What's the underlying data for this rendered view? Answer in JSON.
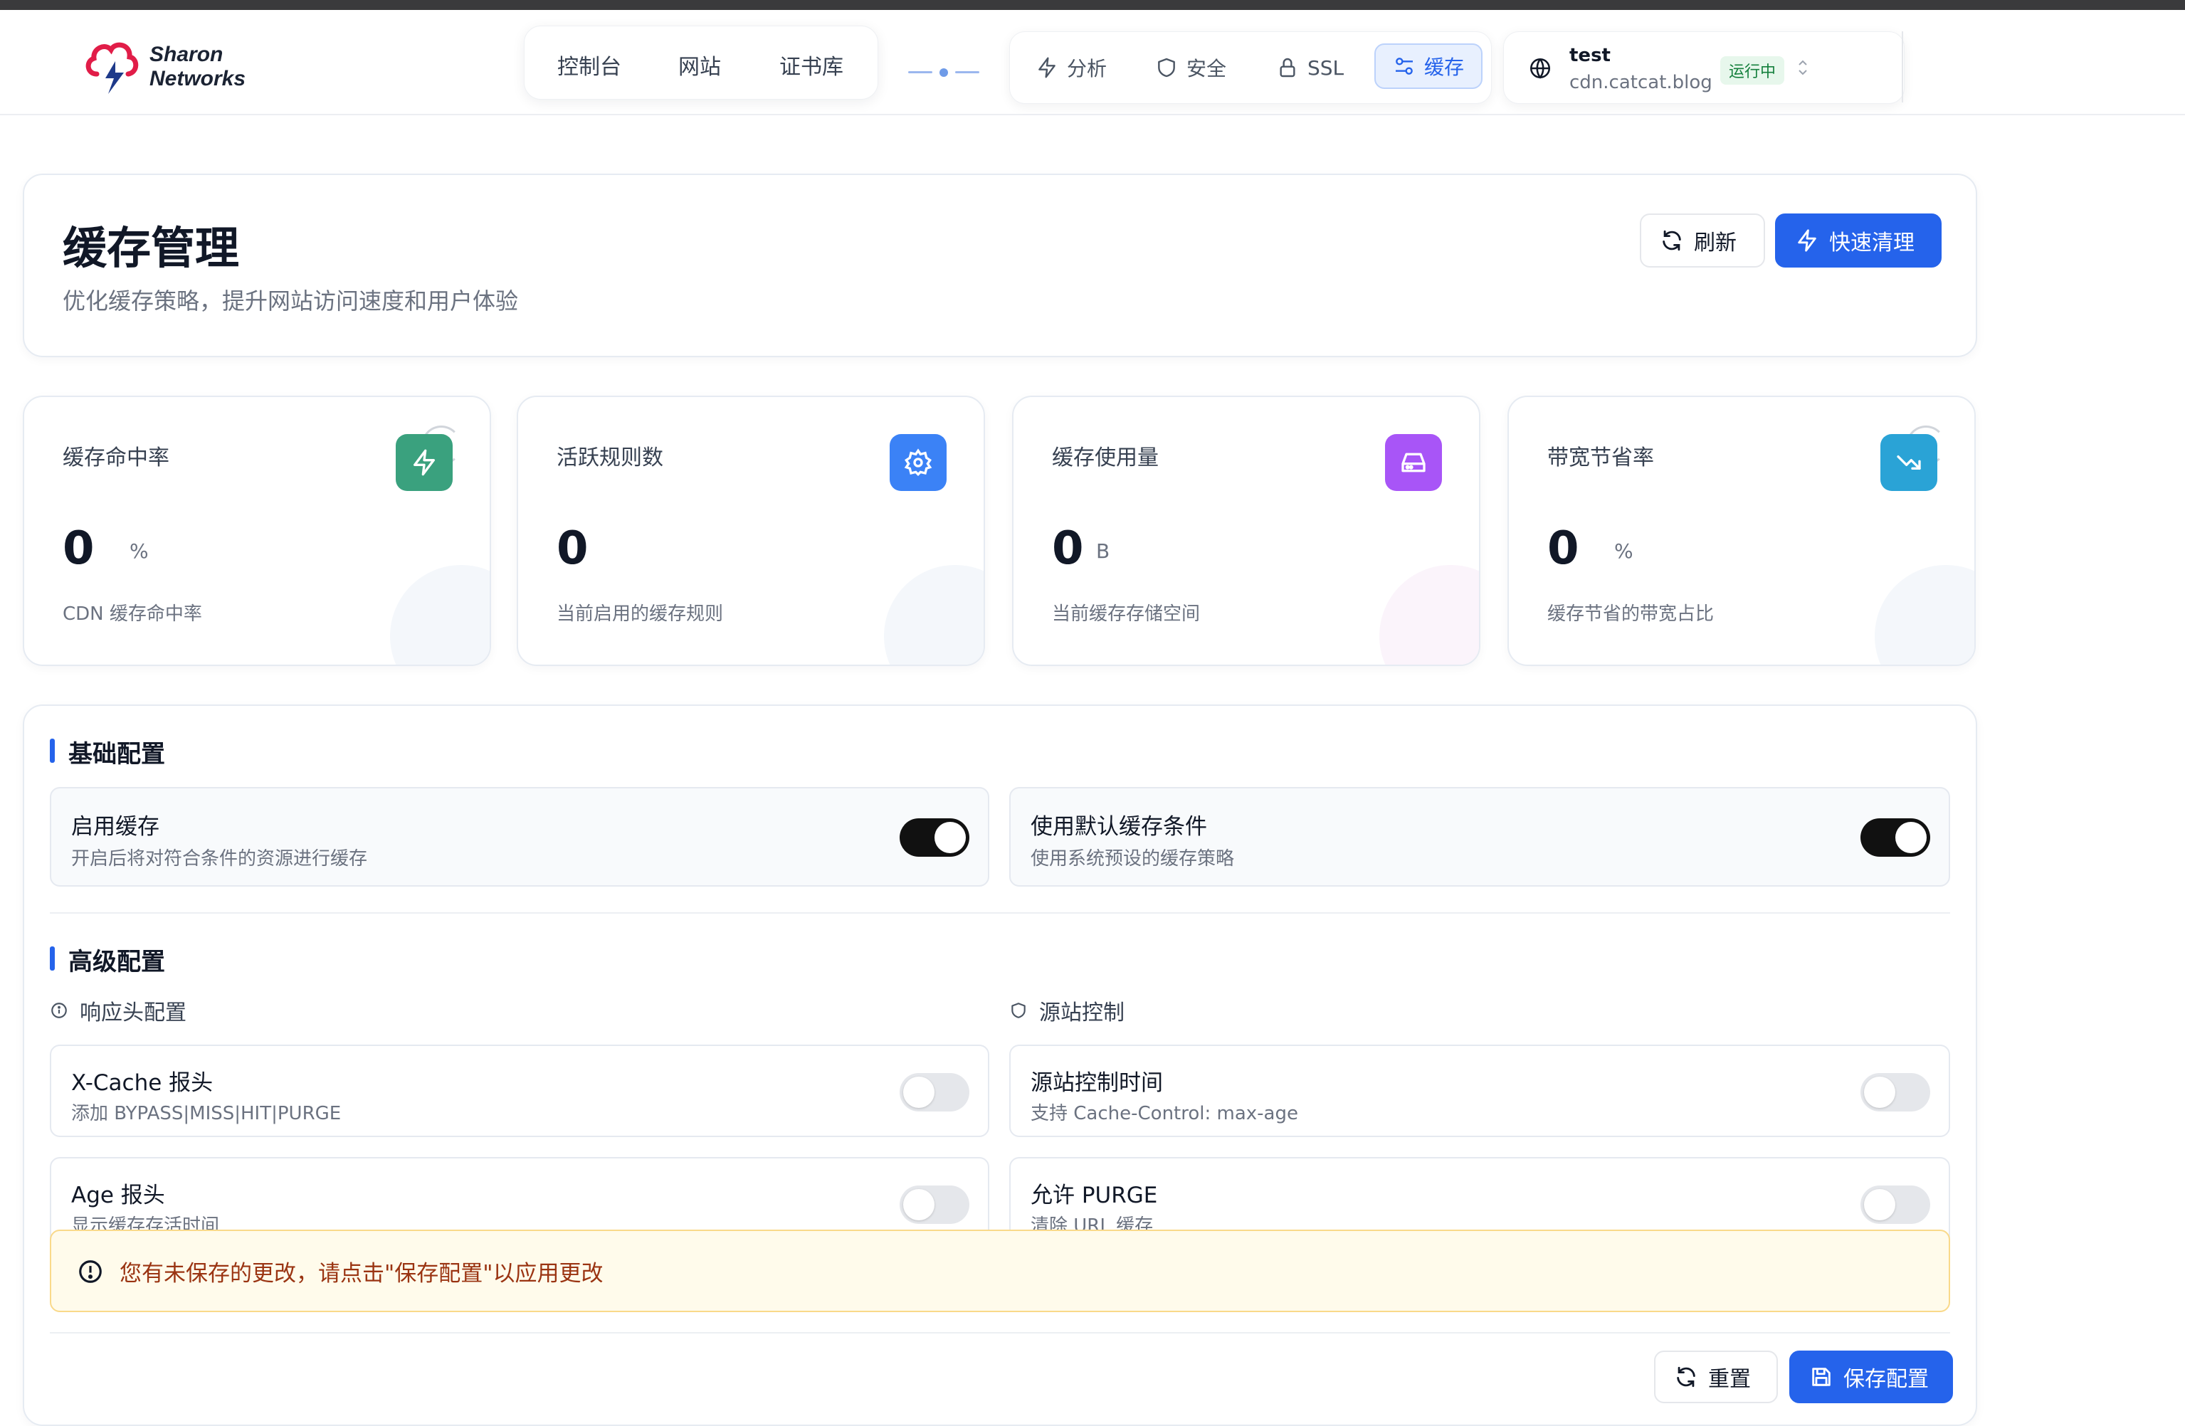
{
  "brand": {
    "name_line1": "Sharon",
    "name_line2": "Networks"
  },
  "top_nav": {
    "items": [
      "控制台",
      "网站",
      "证书库"
    ]
  },
  "site_tabs": [
    {
      "label": "分析",
      "icon": "lightning-icon"
    },
    {
      "label": "安全",
      "icon": "shield-icon"
    },
    {
      "label": "SSL",
      "icon": "lock-icon"
    },
    {
      "label": "缓存",
      "icon": "sliders-icon",
      "active": true
    }
  ],
  "site": {
    "name": "test",
    "domain": "cdn.catcat.blog",
    "status": "运行中"
  },
  "page": {
    "title": "缓存管理",
    "subtitle": "优化缓存策略，提升网站访问速度和用户体验",
    "refresh_label": "刷新",
    "purge_label": "快速清理"
  },
  "stats": [
    {
      "label": "缓存命中率",
      "value": "0",
      "unit": "%",
      "desc": "CDN 缓存命中率",
      "icon": "lightning-icon",
      "color": "#3aa17e"
    },
    {
      "label": "活跃规则数",
      "value": "0",
      "unit": "",
      "desc": "当前启用的缓存规则",
      "icon": "gear-icon",
      "color": "#3b82f6"
    },
    {
      "label": "缓存使用量",
      "value": "0",
      "unit": "B",
      "desc": "当前缓存存储空间",
      "icon": "drive-icon",
      "color": "#a855f7"
    },
    {
      "label": "带宽节省率",
      "value": "0",
      "unit": "%",
      "desc": "缓存节省的带宽占比",
      "icon": "trending-down-icon",
      "color": "#2aa3d6"
    }
  ],
  "basic": {
    "title": "基础配置",
    "options": [
      {
        "title": "启用缓存",
        "desc": "开启后将对符合条件的资源进行缓存",
        "enabled": true
      },
      {
        "title": "使用默认缓存条件",
        "desc": "使用系统预设的缓存策略",
        "enabled": true
      }
    ]
  },
  "advanced": {
    "title": "高级配置",
    "left_group": "响应头配置",
    "right_group": "源站控制",
    "left_options": [
      {
        "title": "X-Cache 报头",
        "desc": "添加 BYPASS|MISS|HIT|PURGE",
        "enabled": false
      },
      {
        "title": "Age 报头",
        "desc": "显示缓存存活时间",
        "enabled": false
      }
    ],
    "right_options": [
      {
        "title": "源站控制时间",
        "desc": "支持 Cache-Control: max-age",
        "enabled": false
      },
      {
        "title": "允许 PURGE",
        "desc": "清除 URL 缓存",
        "enabled": false
      }
    ]
  },
  "warning": "您有未保存的更改，请点击\"保存配置\"以应用更改",
  "footer": {
    "reset_label": "重置",
    "save_label": "保存配置"
  },
  "colors": {
    "primary": "#2563eb",
    "warning_bg": "#fffbeb",
    "warning_text": "#9a3412"
  }
}
